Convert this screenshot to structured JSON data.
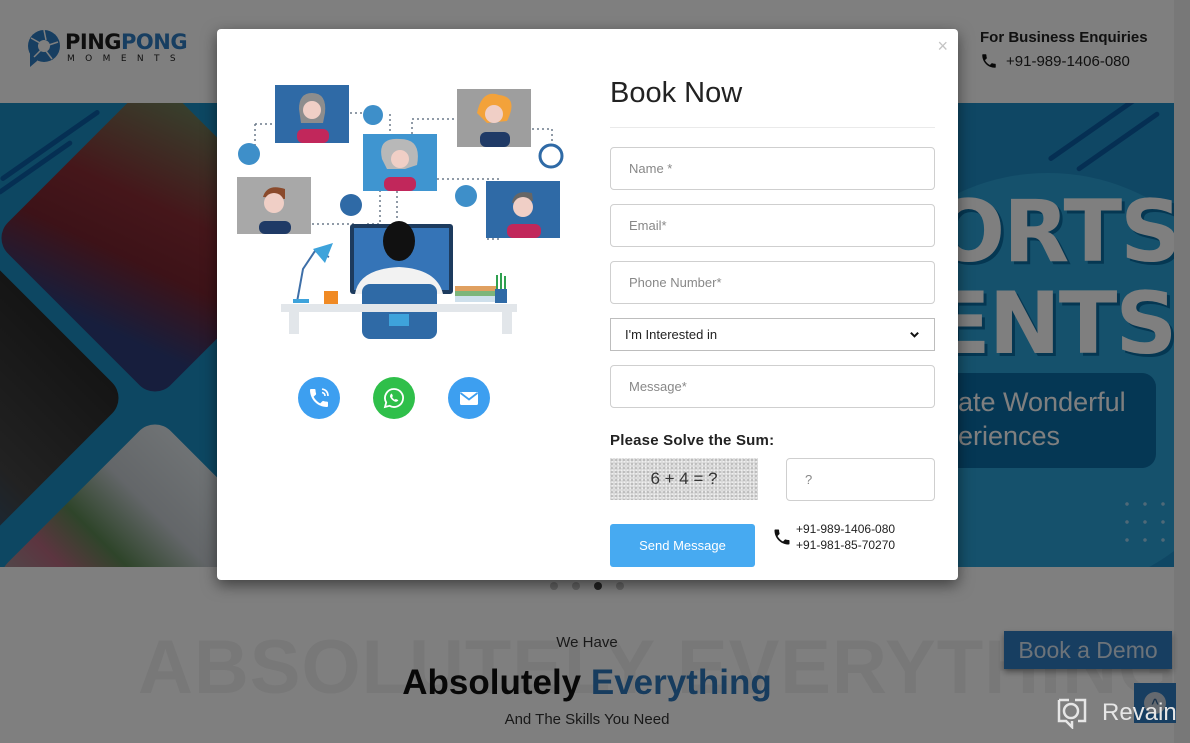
{
  "header": {
    "logo": {
      "line1_a": "PING",
      "line1_b": "PONG",
      "line2": "MOMENTS"
    },
    "business": {
      "title": "For Business Enquiries",
      "phone": "+91-989-1406-080"
    }
  },
  "hero": {
    "headline_l1": "ORTS",
    "headline_l2": "ENTS",
    "tagline_l1": "ate Wonderful",
    "tagline_l2": "eriences",
    "slides": 4,
    "active_slide": 3
  },
  "section": {
    "background_word": "ABSOLUTELY EVERYTHING",
    "kicker": "We Have",
    "headline_a": "Absolutely",
    "headline_b": "Everything",
    "subline": "And The Skills You Need"
  },
  "floating": {
    "book_demo": "Book a Demo",
    "scroll_top": "^",
    "revain": "Revain"
  },
  "modal": {
    "close": "×",
    "title": "Book Now",
    "contact_icons": [
      "phone-call-icon",
      "whatsapp-icon",
      "email-icon"
    ],
    "fields": {
      "name_placeholder": "Name *",
      "email_placeholder": "Email*",
      "phone_placeholder": "Phone Number*",
      "interest_selected": "I'm Interested in",
      "message_placeholder": "Message*"
    },
    "captcha": {
      "label": "Please Solve the Sum:",
      "question": "6 + 4 = ?",
      "answer_placeholder": "?"
    },
    "submit": "Send Message",
    "phones": [
      "+91-989-1406-080",
      "+91-981-85-70270"
    ]
  },
  "colors": {
    "brand_blue": "#2f7cc2",
    "send_button": "#47aaf1",
    "whatsapp_green": "#2fbf4a",
    "hero_blue": "#1b8fc4"
  }
}
